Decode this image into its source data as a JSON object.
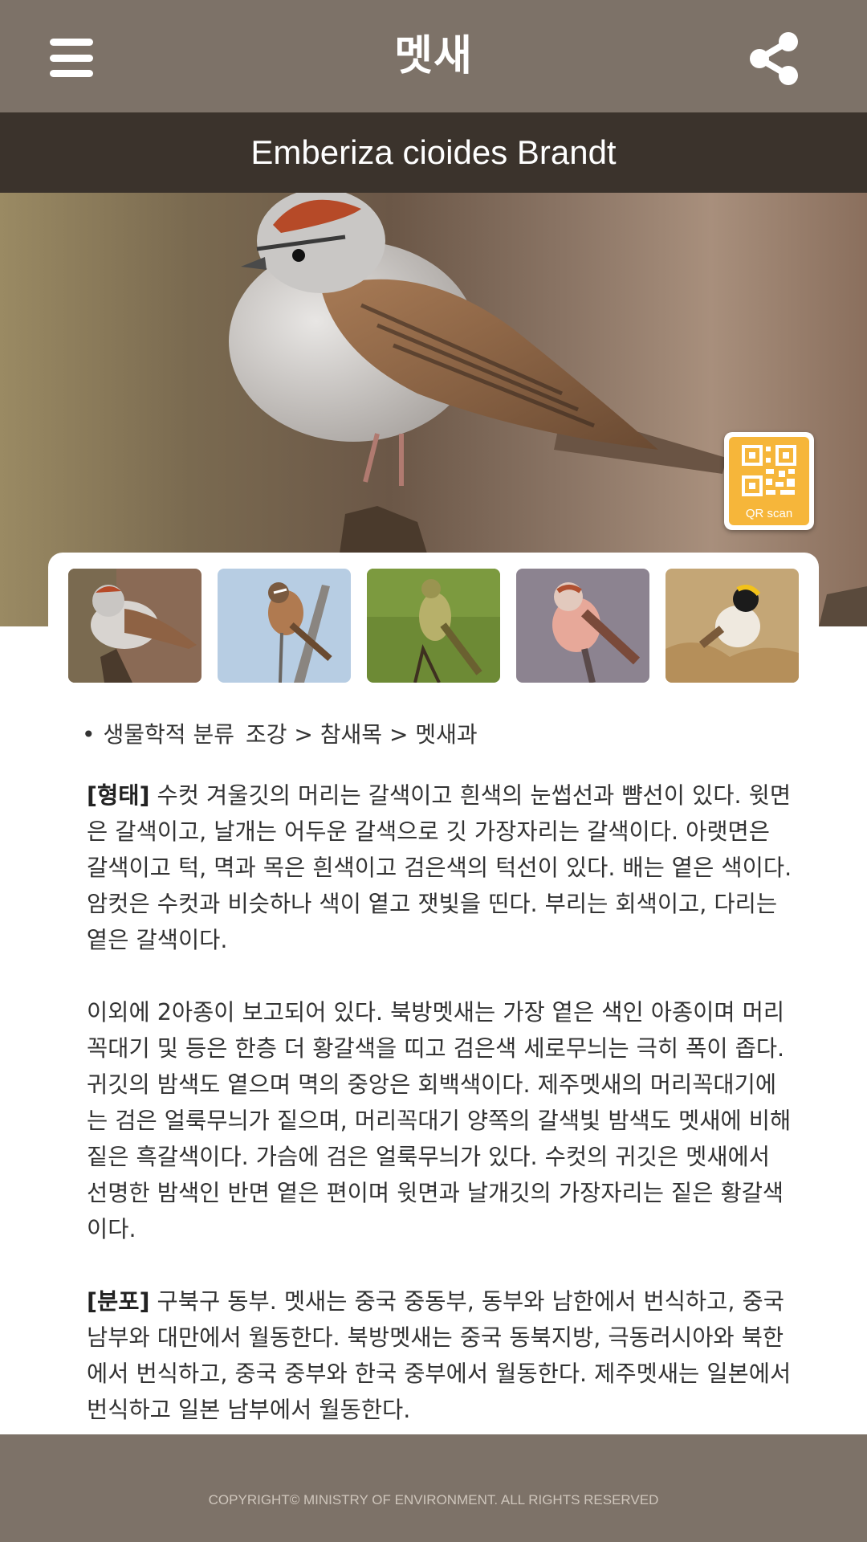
{
  "header": {
    "title": "멧새",
    "menu_icon": "hamburger-menu-icon",
    "share_icon": "share-icon"
  },
  "species": {
    "scientific_name": "Emberiza cioides Brandt"
  },
  "qr": {
    "label": "QR scan",
    "icon": "qr-code-icon",
    "color": "#f6b63a"
  },
  "gallery": {
    "thumbnails": [
      "thumbnail-1",
      "thumbnail-2",
      "thumbnail-3",
      "thumbnail-4",
      "thumbnail-5"
    ]
  },
  "taxonomy": {
    "bullet": "•",
    "label": "생물학적 분류",
    "path": "조강 > 참새목 > 멧새과"
  },
  "description": {
    "form_heading": "[형태]",
    "form_text": " 수컷 겨울깃의 머리는 갈색이고 흰색의 눈썹선과 뺨선이 있다. 윗면은 갈색이고, 날개는 어두운 갈색으로 깃 가장자리는 갈색이다. 아랫면은 갈색이고 턱, 멱과 목은 흰색이고 검은색의 턱선이 있다. 배는 옅은 색이다. 암컷은 수컷과 비슷하나 색이 옅고 잿빛을 띤다. 부리는 회색이고, 다리는 옅은 갈색이다.",
    "subspecies_text": "이외에 2아종이 보고되어 있다. 북방멧새는 가장 옅은 색인 아종이며 머리꼭대기 및 등은 한층 더 황갈색을 띠고 검은색 세로무늬는 극히 폭이 좁다. 귀깃의 밤색도 옅으며 멱의 중앙은 회백색이다. 제주멧새의 머리꼭대기에는 검은 얼룩무늬가 짙으며, 머리꼭대기 양쪽의 갈색빛 밤색도 멧새에 비해 짙은 흑갈색이다. 가슴에 검은 얼룩무늬가 있다. 수컷의 귀깃은 멧새에서 선명한 밤색인 반면 옅은 편이며 윗면과 날개깃의 가장자리는 짙은 황갈색이다.",
    "distribution_heading": "[분포]",
    "distribution_text": " 구북구 동부. 멧새는 중국 중동부, 동부와 남한에서 번식하고, 중국 남부와 대만에서 월동한다. 북방멧새는 중국 동북지방, 극동러시아와 북한에서 번식하고, 중국 중부와 한국 중부에서 월동한다. 제주멧새는 일본에서 번식하고 일본 남부에서 월동한다."
  },
  "footer": {
    "copyright": "COPYRIGHT© MINISTRY OF ENVIRONMENT. ALL RIGHTS RESERVED"
  },
  "colors": {
    "header_bg": "#7d7268",
    "sci_bar_bg": "#3b332c",
    "text": "#333333"
  }
}
